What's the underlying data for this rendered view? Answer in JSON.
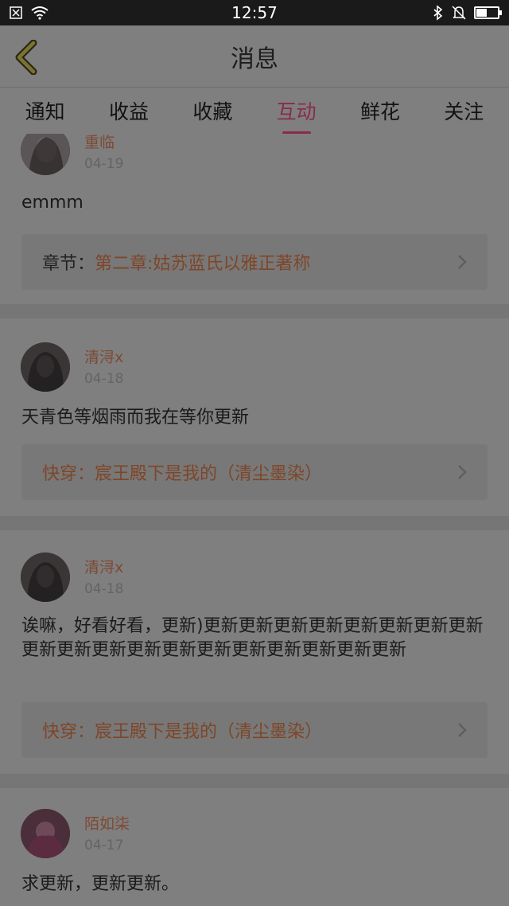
{
  "status_bar": {
    "time": "12:57",
    "battery_level": 0.45
  },
  "header": {
    "title": "消息"
  },
  "tabs": [
    {
      "label": "通知",
      "active": false
    },
    {
      "label": "收益",
      "active": false
    },
    {
      "label": "收藏",
      "active": false
    },
    {
      "label": "互动",
      "active": true
    },
    {
      "label": "鲜花",
      "active": false
    },
    {
      "label": "关注",
      "active": false
    }
  ],
  "messages": [
    {
      "user": "重临",
      "date": "04-19",
      "comment": "emmm",
      "link_label": "章节：",
      "link_text": "第二章:姑苏蓝氏以雅正著称"
    },
    {
      "user": "清浔x",
      "date": "04-18",
      "comment": "天青色等烟雨而我在等你更新",
      "link_label": "",
      "link_text": "快穿：宸王殿下是我的（清尘墨染）"
    },
    {
      "user": "清浔x",
      "date": "04-18",
      "comment": "诶嘛，好看好看，更新)更新更新更新更新更新更新更新更新更新更新更新更新更新更新更新更新更新更新更新",
      "link_label": "",
      "link_text": "快穿：宸王殿下是我的（清尘墨染）"
    },
    {
      "user": "陌如柒",
      "date": "04-17",
      "comment": "求更新，更新更新。"
    }
  ],
  "colors": {
    "accent": "#8b2a4e",
    "link": "#7e4628",
    "overlay_bg": "#7f7f7f"
  }
}
